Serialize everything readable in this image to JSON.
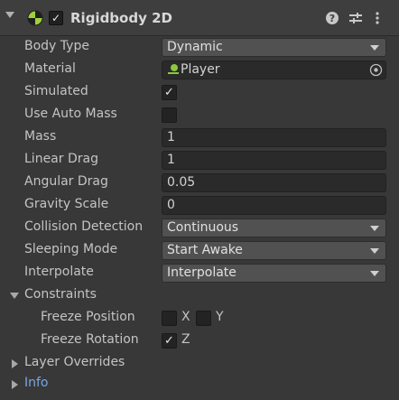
{
  "component": {
    "title": "Rigidbody 2D",
    "enabled_mark": "✓",
    "help_icon": "help-icon",
    "preset_icon": "preset-sliders-icon",
    "menu_icon": "kebab-menu-icon"
  },
  "fields": {
    "body_type": {
      "label": "Body Type",
      "value": "Dynamic"
    },
    "material": {
      "label": "Material",
      "value": "Player"
    },
    "simulated": {
      "label": "Simulated",
      "checked": true,
      "mark": "✓"
    },
    "use_auto_mass": {
      "label": "Use Auto Mass",
      "checked": false
    },
    "mass": {
      "label": "Mass",
      "value": "1"
    },
    "linear_drag": {
      "label": "Linear Drag",
      "value": "1"
    },
    "angular_drag": {
      "label": "Angular Drag",
      "value": "0.05"
    },
    "gravity_scale": {
      "label": "Gravity Scale",
      "value": "0"
    },
    "collision_detection": {
      "label": "Collision Detection",
      "value": "Continuous"
    },
    "sleeping_mode": {
      "label": "Sleeping Mode",
      "value": "Start Awake"
    },
    "interpolate": {
      "label": "Interpolate",
      "value": "Interpolate"
    }
  },
  "constraints": {
    "label": "Constraints",
    "freeze_position": {
      "label": "Freeze Position",
      "x_label": "X",
      "x_checked": false,
      "y_label": "Y",
      "y_checked": false
    },
    "freeze_rotation": {
      "label": "Freeze Rotation",
      "z_label": "Z",
      "z_checked": true,
      "mark": "✓"
    }
  },
  "sections": {
    "layer_overrides": "Layer Overrides",
    "info": "Info"
  },
  "colors": {
    "background": "#383838",
    "field_bg": "#2a2a2a",
    "dropdown_bg": "#515151",
    "link_blue": "#7aa7e0",
    "icon_green": "#6fc11b"
  }
}
